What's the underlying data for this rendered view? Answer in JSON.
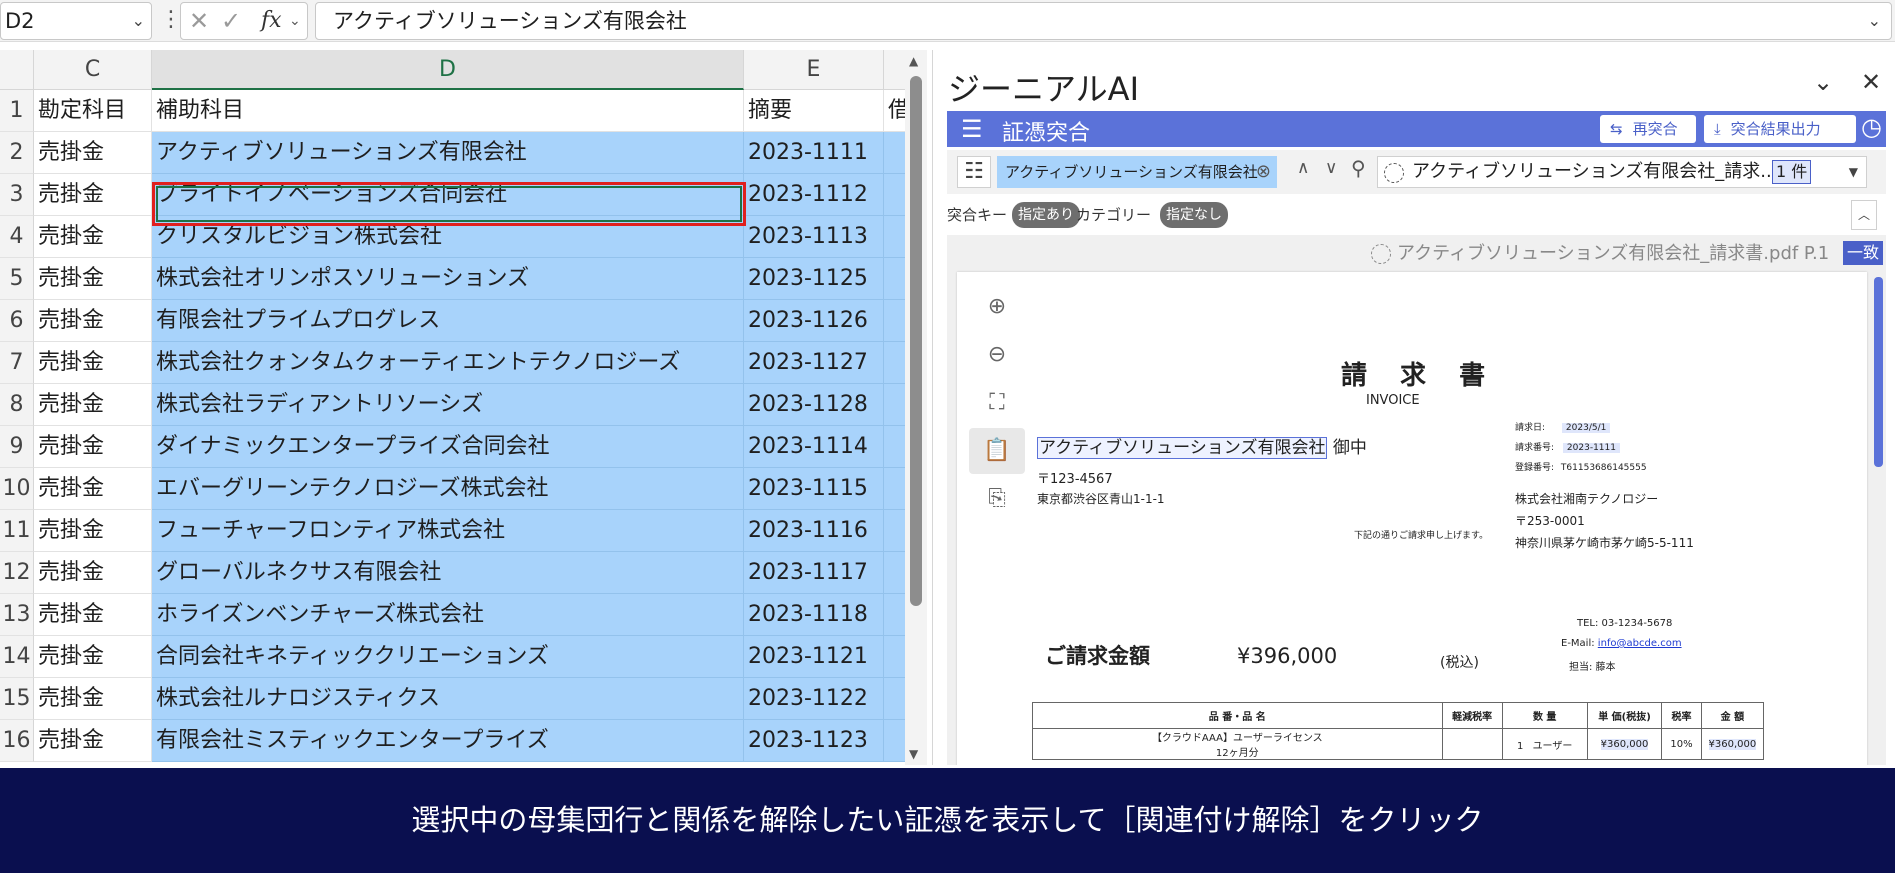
{
  "formula_bar": {
    "name_box": "D2",
    "formula": "アクティブソリューションズ有限会社",
    "fx_label": "fx"
  },
  "sheet": {
    "columns": [
      "C",
      "D",
      "E"
    ],
    "selected_column": "D",
    "header_row": {
      "row": "1",
      "c": "勘定科目",
      "d": "補助科目",
      "e": "摘要",
      "f": "借"
    },
    "rows": [
      {
        "row": "2",
        "c": "売掛金",
        "d": "アクティブソリューションズ有限会社",
        "e": "2023-1111"
      },
      {
        "row": "3",
        "c": "売掛金",
        "d": "ブライトイノベーションズ合同会社",
        "e": "2023-1112"
      },
      {
        "row": "4",
        "c": "売掛金",
        "d": "クリスタルビジョン株式会社",
        "e": "2023-1113"
      },
      {
        "row": "5",
        "c": "売掛金",
        "d": "株式会社オリンポスソリューションズ",
        "e": "2023-1125"
      },
      {
        "row": "6",
        "c": "売掛金",
        "d": "有限会社プライムプログレス",
        "e": "2023-1126"
      },
      {
        "row": "7",
        "c": "売掛金",
        "d": "株式会社クォンタムクォーティエントテクノロジーズ",
        "e": "2023-1127"
      },
      {
        "row": "8",
        "c": "売掛金",
        "d": "株式会社ラディアントリソーシズ",
        "e": "2023-1128"
      },
      {
        "row": "9",
        "c": "売掛金",
        "d": "ダイナミックエンタープライズ合同会社",
        "e": "2023-1114"
      },
      {
        "row": "10",
        "c": "売掛金",
        "d": "エバーグリーンテクノロジーズ株式会社",
        "e": "2023-1115"
      },
      {
        "row": "11",
        "c": "売掛金",
        "d": "フューチャーフロンティア株式会社",
        "e": "2023-1116"
      },
      {
        "row": "12",
        "c": "売掛金",
        "d": "グローバルネクサス有限会社",
        "e": "2023-1117"
      },
      {
        "row": "13",
        "c": "売掛金",
        "d": "ホライズンベンチャーズ株式会社",
        "e": "2023-1118"
      },
      {
        "row": "14",
        "c": "売掛金",
        "d": "合同会社キネティッククリエーションズ",
        "e": "2023-1121"
      },
      {
        "row": "15",
        "c": "売掛金",
        "d": "株式会社ルナロジスティクス",
        "e": "2023-1122"
      },
      {
        "row": "16",
        "c": "売掛金",
        "d": "有限会社ミスティックエンタープライズ",
        "e": "2023-1123"
      }
    ]
  },
  "panel": {
    "title": "ジーニアルAI",
    "app_name": "証憑突合",
    "rematch_label": "再突合",
    "export_label": "突合結果出力",
    "search_value": "アクティブソリューションズ有限会社",
    "doc_select": "アクティブソリューションズ有限会社_請求...",
    "doc_count": "1 件",
    "key_label": "突合キー",
    "key_chip": "指定あり",
    "category_label": "カテゴリー",
    "category_chip": "指定なし",
    "viewer_file": "アクティブソリューションズ有限会社_請求書.pdf P.1",
    "match_badge": "一致"
  },
  "invoice": {
    "title": "請 求 書",
    "subtitle": "INVOICE",
    "to_name": "アクティブソリューションズ有限会社",
    "to_suffix": "御中",
    "zip": "〒123-4567",
    "address": "東京都渋谷区青山1-1-1",
    "note": "下記の通りご請求申し上げます。",
    "date_label": "請求日:",
    "date_value": "2023/5/1",
    "number_label": "請求番号:",
    "number_value": "2023-1111",
    "reg_label": "登録番号:",
    "reg_value": "T61153686145555",
    "company": "株式会社湘南テクノロジー",
    "company_zip": "〒253-0001",
    "company_address": "神奈川県茅ケ崎市茅ケ崎5-5-111",
    "tel": "TEL: 03-1234-5678",
    "email_label": "E-Mail:",
    "email": "info@abcde.com",
    "contact": "担当: 藤本",
    "amount_label": "ご請求金額",
    "amount": "¥396,000",
    "tax_note": "(税込)",
    "table_headers": [
      "品 番・品 名",
      "軽減税率",
      "数 量",
      "単 価(税抜)",
      "税率",
      "金 額"
    ],
    "item_name_1": "【クラウドAAA】ユーザーライセンス",
    "item_name_2": "12ヶ月分",
    "item_qty": "1",
    "item_unit": "ユーザー",
    "item_price": "¥360,000",
    "item_rate": "10%",
    "item_amount": "¥360,000"
  },
  "caption": "選択中の母集団行と関係を解除したい証憑を表示して［関連付け解除］をクリック"
}
